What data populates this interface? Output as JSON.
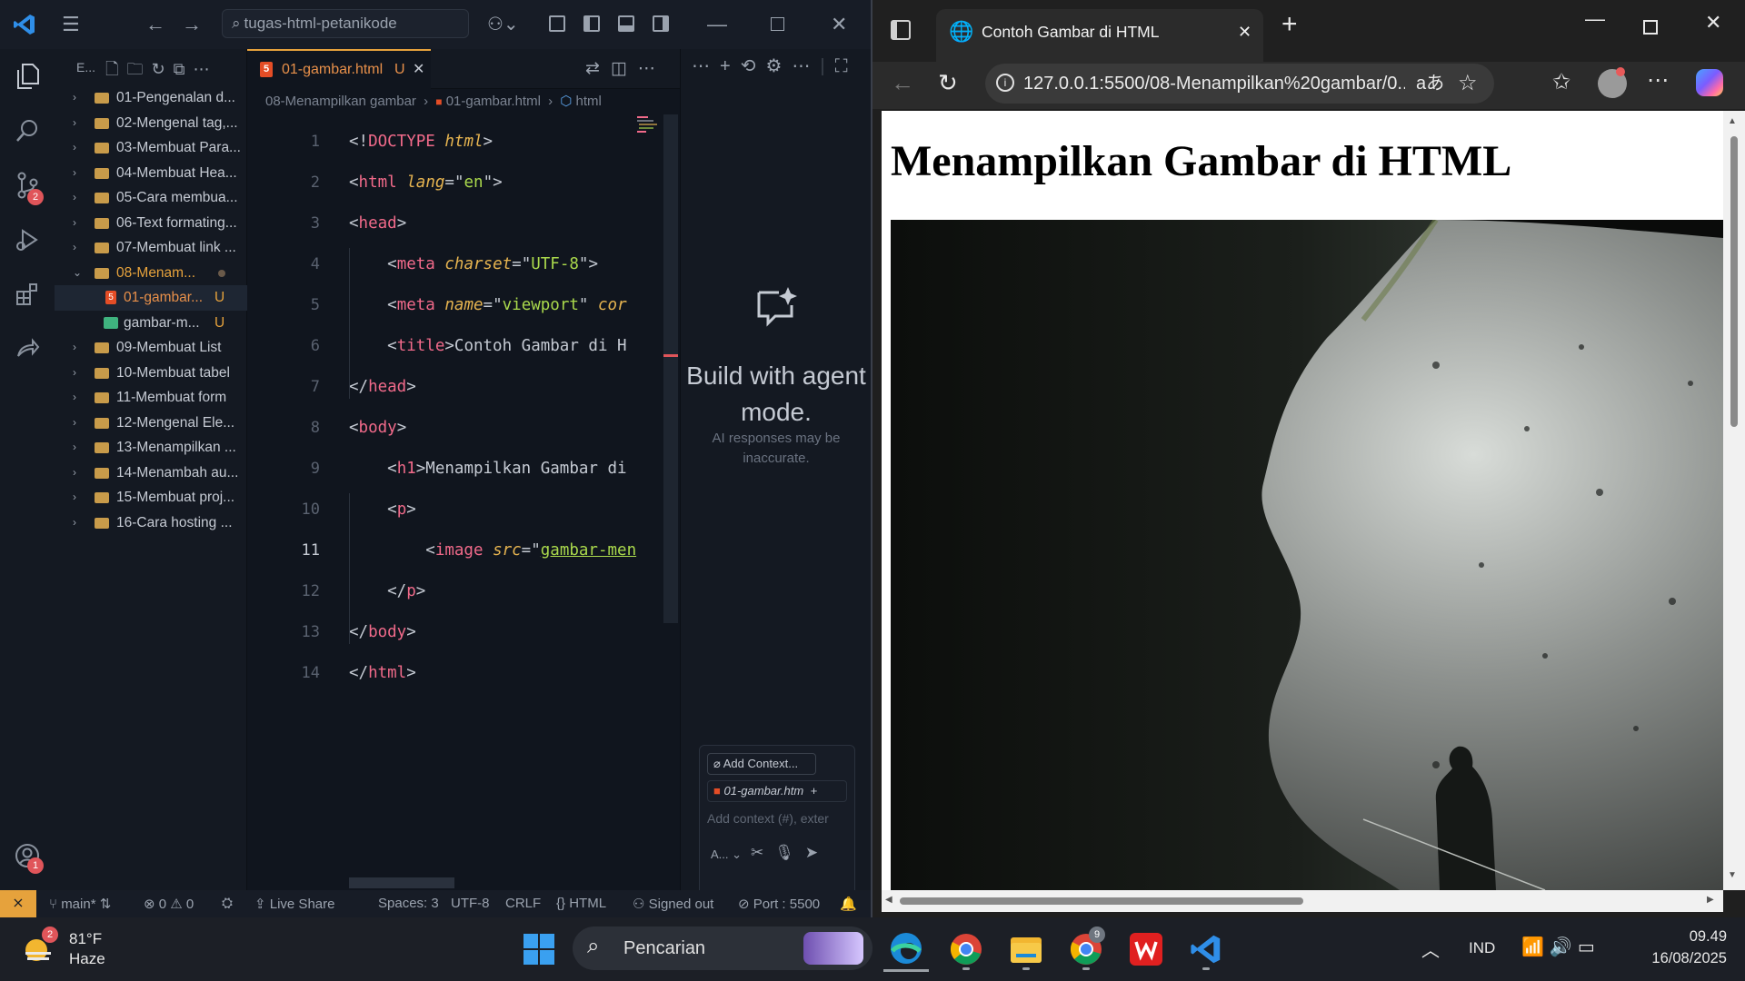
{
  "vscode": {
    "search_text": "tugas-html-petanikode",
    "activity_badges": {
      "source_control": "2",
      "accounts": "1"
    },
    "explorer": {
      "header": "E...",
      "folders": [
        "01-Pengenalan d...",
        "02-Mengenal tag,...",
        "03-Membuat Para...",
        "04-Membuat Hea...",
        "05-Cara membua...",
        "06-Text formating...",
        "07-Membuat link ...",
        "08-Menam...",
        "09-Membuat List",
        "10-Membuat tabel",
        "11-Membuat form",
        "12-Mengenal Ele...",
        "13-Menampilkan ...",
        "14-Menambah au...",
        "15-Membuat proj...",
        "16-Cara hosting ..."
      ],
      "open_folder_children": [
        {
          "name": "01-gambar...",
          "status": "U"
        },
        {
          "name": "gambar-m...",
          "status": "U"
        }
      ]
    },
    "tab": {
      "label": "01-gambar.html",
      "status": "U"
    },
    "breadcrumb": {
      "folder": "08-Menampilkan gambar",
      "file": "01-gambar.html",
      "symbol": "html"
    },
    "code_lines": [
      {
        "n": "1",
        "tokens": [
          [
            "p",
            "<!"
          ],
          [
            "t",
            "DOCTYPE"
          ],
          [
            "p",
            " "
          ],
          [
            "a",
            "html"
          ],
          [
            "p",
            ">"
          ]
        ]
      },
      {
        "n": "2",
        "tokens": [
          [
            "p",
            "<"
          ],
          [
            "t",
            "html"
          ],
          [
            "p",
            " "
          ],
          [
            "a",
            "lang"
          ],
          [
            "p",
            "=\""
          ],
          [
            "s",
            "en"
          ],
          [
            "p",
            "\">"
          ]
        ]
      },
      {
        "n": "3",
        "tokens": [
          [
            "p",
            "<"
          ],
          [
            "t",
            "head"
          ],
          [
            "p",
            ">"
          ]
        ]
      },
      {
        "n": "4",
        "tokens": [
          [
            "p",
            "    <"
          ],
          [
            "t",
            "meta"
          ],
          [
            "p",
            " "
          ],
          [
            "a",
            "charset"
          ],
          [
            "p",
            "=\""
          ],
          [
            "s",
            "UTF-8"
          ],
          [
            "p",
            "\">"
          ]
        ]
      },
      {
        "n": "5",
        "tokens": [
          [
            "p",
            "    <"
          ],
          [
            "t",
            "meta"
          ],
          [
            "p",
            " "
          ],
          [
            "a",
            "name"
          ],
          [
            "p",
            "=\""
          ],
          [
            "s",
            "viewport"
          ],
          [
            "p",
            "\" "
          ],
          [
            "a",
            "cor"
          ]
        ]
      },
      {
        "n": "6",
        "tokens": [
          [
            "p",
            "    <"
          ],
          [
            "t",
            "title"
          ],
          [
            "p",
            ">Contoh Gambar di H"
          ]
        ]
      },
      {
        "n": "7",
        "tokens": [
          [
            "p",
            "</"
          ],
          [
            "t",
            "head"
          ],
          [
            "p",
            ">"
          ]
        ]
      },
      {
        "n": "8",
        "tokens": [
          [
            "p",
            "<"
          ],
          [
            "t",
            "body"
          ],
          [
            "p",
            ">"
          ]
        ]
      },
      {
        "n": "9",
        "tokens": [
          [
            "p",
            "    <"
          ],
          [
            "t",
            "h1"
          ],
          [
            "p",
            ">Menampilkan Gambar di"
          ]
        ]
      },
      {
        "n": "10",
        "tokens": [
          [
            "p",
            "    <"
          ],
          [
            "t",
            "p"
          ],
          [
            "p",
            ">"
          ]
        ]
      },
      {
        "n": "11",
        "tokens": [
          [
            "p",
            "        <"
          ],
          [
            "t",
            "image"
          ],
          [
            "p",
            " "
          ],
          [
            "a",
            "src"
          ],
          [
            "p",
            "=\""
          ],
          [
            "s",
            "gambar-men"
          ]
        ]
      },
      {
        "n": "12",
        "tokens": [
          [
            "p",
            "    </"
          ],
          [
            "t",
            "p"
          ],
          [
            "p",
            ">"
          ]
        ]
      },
      {
        "n": "13",
        "tokens": [
          [
            "p",
            "</"
          ],
          [
            "t",
            "body"
          ],
          [
            "p",
            ">"
          ]
        ]
      },
      {
        "n": "14",
        "tokens": [
          [
            "p",
            "</"
          ],
          [
            "t",
            "html"
          ],
          [
            "p",
            ">"
          ]
        ]
      }
    ],
    "chat": {
      "title": "Build with agent mode.",
      "subtitle": "AI responses may be inaccurate.",
      "add_context": "Add Context...",
      "file_chip": "01-gambar.htm",
      "placeholder": "Add context (#), exter",
      "mode": "A..."
    },
    "status": {
      "branch": "main*",
      "errors": "0",
      "warnings": "0",
      "live_share": "Live Share",
      "spaces": "Spaces: 3",
      "encoding": "UTF-8",
      "eol": "CRLF",
      "language": "HTML",
      "signed": "Signed out",
      "port": "Port : 5500"
    }
  },
  "browser": {
    "tab_title": "Contoh Gambar di HTML",
    "url": "127.0.0.1:5500/08-Menampilkan%20gambar/0...",
    "page_heading": "Menampilkan Gambar di HTML"
  },
  "taskbar": {
    "weather_temp": "81°F",
    "weather_desc": "Haze",
    "weather_badge": "2",
    "search_placeholder": "Pencarian",
    "chrome_badge": "9",
    "language": "IND",
    "time": "09.49",
    "date": "16/08/2025"
  },
  "colors": {
    "accent_orange": "#e6a23c",
    "code_tag": "#f16a8a",
    "code_attr": "#e6b450",
    "code_string": "#aad94c"
  }
}
